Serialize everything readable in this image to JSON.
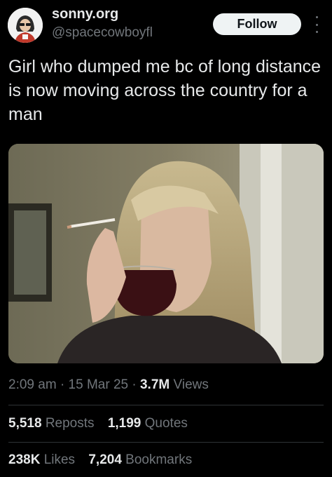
{
  "author": {
    "display_name": "sonny.org",
    "handle": "@spacecowboyfl"
  },
  "follow_button": {
    "label": "Follow"
  },
  "more_menu": {
    "icon": "more-vertical-icon"
  },
  "tweet": {
    "text": "Girl who dumped me bc of long distance is now moving across the country for a man"
  },
  "meta": {
    "time": "2:09 am",
    "sep1": "·",
    "date": "15 Mar 25",
    "sep2": "·",
    "views_count": "3.7M",
    "views_label": "Views"
  },
  "stats": {
    "reposts_count": "5,518",
    "reposts_label": "Reposts",
    "quotes_count": "1,199",
    "quotes_label": "Quotes",
    "likes_count": "238K",
    "likes_label": "Likes",
    "bookmarks_count": "7,204",
    "bookmarks_label": "Bookmarks"
  },
  "colors": {
    "background": "#000000",
    "text_primary": "#e7e9ea",
    "text_secondary": "#71767b",
    "follow_bg": "#eff3f4",
    "divider": "#2f3336"
  }
}
